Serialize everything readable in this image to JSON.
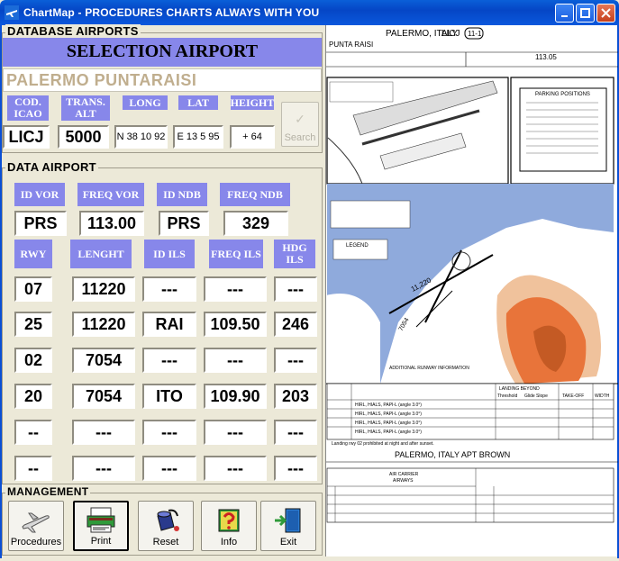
{
  "window": {
    "title": "ChartMap - PROCEDURES CHARTS ALWAYS WITH YOU"
  },
  "database": {
    "group_label": "DATABASE AIRPORTS",
    "header": "SELECTION AIRPORT",
    "airport_name": "PALERMO PUNTARAISI",
    "labels": {
      "icao": "COD. ICAO",
      "trans_alt": "TRANS. ALT",
      "long": "LONG",
      "lat": "LAT",
      "height": "HEIGHT"
    },
    "values": {
      "icao": "LICJ",
      "trans_alt": "5000",
      "long": "N 38 10 92",
      "lat": "E 13 5 95",
      "height": "+ 64"
    },
    "search_label": "Search"
  },
  "data_airport": {
    "group_label": "DATA AIRPORT",
    "nav_labels": {
      "id_vor": "ID VOR",
      "freq_vor": "FREQ VOR",
      "id_ndb": "ID NDB",
      "freq_ndb": "FREQ NDB"
    },
    "nav_values": {
      "id_vor": "PRS",
      "freq_vor": "113.00",
      "id_ndb": "PRS",
      "freq_ndb": "329"
    },
    "runway_headers": {
      "rwy": "RWY",
      "length": "LENGHT",
      "id_ils": "ID ILS",
      "freq_ils": "FREQ ILS",
      "hdg_ils": "HDG ILS"
    },
    "runways": [
      {
        "rwy": "07",
        "length": "11220",
        "id_ils": "---",
        "freq_ils": "---",
        "hdg_ils": "---"
      },
      {
        "rwy": "25",
        "length": "11220",
        "id_ils": "RAI",
        "freq_ils": "109.50",
        "hdg_ils": "246"
      },
      {
        "rwy": "02",
        "length": "7054",
        "id_ils": "---",
        "freq_ils": "---",
        "hdg_ils": "---"
      },
      {
        "rwy": "20",
        "length": "7054",
        "id_ils": "ITO",
        "freq_ils": "109.90",
        "hdg_ils": "203"
      },
      {
        "rwy": "--",
        "length": "---",
        "id_ils": "---",
        "freq_ils": "---",
        "hdg_ils": "---"
      },
      {
        "rwy": "--",
        "length": "---",
        "id_ils": "---",
        "freq_ils": "---",
        "hdg_ils": "---"
      }
    ]
  },
  "management": {
    "group_label": "MANAGEMENT",
    "buttons": {
      "procedures": "Procedures",
      "print": "Print",
      "reset": "Reset",
      "info": "Info",
      "exit": "Exit"
    }
  },
  "chart": {
    "header_city": "PALERMO, ITALY",
    "header_icao": "LICJ",
    "header_page": "11-1",
    "airport_name": "PUNTA RAISI",
    "freq": "113.05",
    "bottom_title": "PALERMO, ITALY APT BROWN",
    "legend": "LEGEND",
    "rwy_label": "11,220",
    "rwy_label2": "7054",
    "section_title": "ADDITIONAL RUNWAY INFORMATION",
    "parking_title": "PARKING POSITIONS",
    "landing_title": "LANDING BEYOND",
    "col_threshold": "Threshold",
    "col_glide": "Glide Slope",
    "col_takeoff": "TAKE-OFF",
    "col_width": "WIDTH",
    "row_labels": [
      "HIRL, HIALS, PAPI-L (angle 3.0°)",
      "HIRL, HIALS, PAPI-L (angle 3.0°)",
      "HIRL, HIALS, PAPI-L (angle 3.0°)",
      "HIRL, HIALS, PAPI-L (angle 3.0°)"
    ],
    "caution_note": "Landing rwy 02 prohibited at night and after sunset.",
    "alt_table_title": "AIR CARRIER",
    "alt_table_sub": "AIRWAYS"
  },
  "colors": {
    "label_bg": "#8787ea",
    "title_bar": "#0546c6",
    "terrain": "#e8743a"
  }
}
